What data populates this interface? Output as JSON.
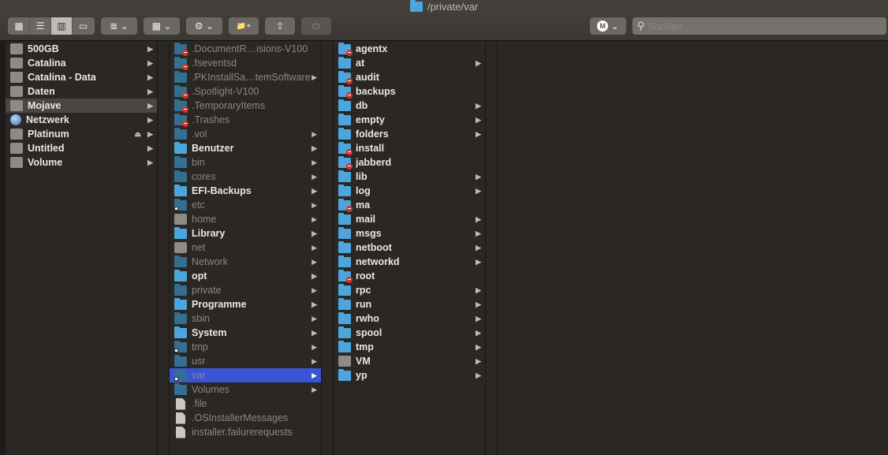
{
  "window": {
    "title": "/private/var"
  },
  "toolbar": {
    "view_icon": "▦",
    "view_list": "☰",
    "view_columns": "▥",
    "view_gallery": "▭",
    "group_icon": "≣",
    "arrange_icon": "▦",
    "action_icon": "⚙",
    "chevron": "⌄",
    "new_folder_icon": "📁+",
    "share_icon": "⇪",
    "tag_icon": "⬭",
    "profile_icon": "M"
  },
  "search": {
    "placeholder": "Suchen",
    "icon": "⚲"
  },
  "sidebar": [
    {
      "label": "500GB",
      "icon": "disk",
      "arrow": true
    },
    {
      "label": "Catalina",
      "icon": "disk",
      "arrow": true
    },
    {
      "label": "Catalina - Data",
      "icon": "disk",
      "arrow": true
    },
    {
      "label": "Daten",
      "icon": "disk",
      "arrow": true
    },
    {
      "label": "Mojave",
      "icon": "disk",
      "arrow": true,
      "selected": true
    },
    {
      "label": "Netzwerk",
      "icon": "globe",
      "arrow": true
    },
    {
      "label": "Platinum",
      "icon": "disk",
      "arrow": true,
      "eject": true
    },
    {
      "label": "Untitled",
      "icon": "disk",
      "arrow": true
    },
    {
      "label": "Volume",
      "icon": "disk",
      "arrow": true
    }
  ],
  "column2": [
    {
      "label": ".DocumentR…isions-V100",
      "icon": "restricted",
      "dim": true
    },
    {
      "label": ".fseventsd",
      "icon": "restricted",
      "dim": true
    },
    {
      "label": ".PKInstallSa…temSoftware",
      "icon": "folder",
      "dim": true,
      "arrow": true
    },
    {
      "label": ".Spotlight-V100",
      "icon": "restricted",
      "dim": true
    },
    {
      "label": ".TemporaryItems",
      "icon": "restricted",
      "dim": true
    },
    {
      "label": ".Trashes",
      "icon": "restricted",
      "dim": true
    },
    {
      "label": ".vol",
      "icon": "folder",
      "dim": true,
      "arrow": true
    },
    {
      "label": "Benutzer",
      "icon": "folder",
      "arrow": true
    },
    {
      "label": "bin",
      "icon": "folder",
      "dim": true,
      "arrow": true
    },
    {
      "label": "cores",
      "icon": "folder",
      "dim": true,
      "arrow": true
    },
    {
      "label": "EFI-Backups",
      "icon": "folder",
      "arrow": true
    },
    {
      "label": "etc",
      "icon": "alias",
      "dim": true,
      "arrow": true
    },
    {
      "label": "home",
      "icon": "disk",
      "dim": true,
      "arrow": true
    },
    {
      "label": "Library",
      "icon": "folder",
      "arrow": true
    },
    {
      "label": "net",
      "icon": "disk",
      "dim": true,
      "arrow": true
    },
    {
      "label": "Network",
      "icon": "folder",
      "dim": true,
      "arrow": true
    },
    {
      "label": "opt",
      "icon": "folder",
      "arrow": true
    },
    {
      "label": "private",
      "icon": "folder",
      "dim": true,
      "arrow": true
    },
    {
      "label": "Programme",
      "icon": "folder",
      "arrow": true
    },
    {
      "label": "sbin",
      "icon": "folder",
      "dim": true,
      "arrow": true
    },
    {
      "label": "System",
      "icon": "folder",
      "arrow": true
    },
    {
      "label": "tmp",
      "icon": "alias",
      "dim": true,
      "arrow": true
    },
    {
      "label": "usr",
      "icon": "folder",
      "dim": true,
      "arrow": true
    },
    {
      "label": "var",
      "icon": "alias",
      "dim": true,
      "arrow": true,
      "selected": true
    },
    {
      "label": "Volumes",
      "icon": "folder",
      "dim": true,
      "arrow": true
    },
    {
      "label": ".file",
      "icon": "file",
      "dim": true
    },
    {
      "label": ".OSInstallerMessages",
      "icon": "file",
      "dim": true
    },
    {
      "label": "installer.failurerequests",
      "icon": "file",
      "dim": true
    }
  ],
  "column3": [
    {
      "label": "agentx",
      "icon": "restricted"
    },
    {
      "label": "at",
      "icon": "folder",
      "arrow": true
    },
    {
      "label": "audit",
      "icon": "restricted"
    },
    {
      "label": "backups",
      "icon": "restricted"
    },
    {
      "label": "db",
      "icon": "folder",
      "arrow": true
    },
    {
      "label": "empty",
      "icon": "folder",
      "arrow": true
    },
    {
      "label": "folders",
      "icon": "folder",
      "arrow": true
    },
    {
      "label": "install",
      "icon": "restricted"
    },
    {
      "label": "jabberd",
      "icon": "restricted"
    },
    {
      "label": "lib",
      "icon": "folder",
      "arrow": true
    },
    {
      "label": "log",
      "icon": "folder",
      "arrow": true
    },
    {
      "label": "ma",
      "icon": "restricted"
    },
    {
      "label": "mail",
      "icon": "folder",
      "arrow": true
    },
    {
      "label": "msgs",
      "icon": "folder",
      "arrow": true
    },
    {
      "label": "netboot",
      "icon": "folder",
      "arrow": true
    },
    {
      "label": "networkd",
      "icon": "folder",
      "arrow": true
    },
    {
      "label": "root",
      "icon": "restricted"
    },
    {
      "label": "rpc",
      "icon": "folder",
      "arrow": true
    },
    {
      "label": "run",
      "icon": "folder",
      "arrow": true
    },
    {
      "label": "rwho",
      "icon": "folder",
      "arrow": true
    },
    {
      "label": "spool",
      "icon": "folder",
      "arrow": true
    },
    {
      "label": "tmp",
      "icon": "folder",
      "arrow": true
    },
    {
      "label": "VM",
      "icon": "disk",
      "arrow": true
    },
    {
      "label": "yp",
      "icon": "folder",
      "arrow": true
    }
  ],
  "arrow_glyph": "▶",
  "eject_glyph": "⏏"
}
